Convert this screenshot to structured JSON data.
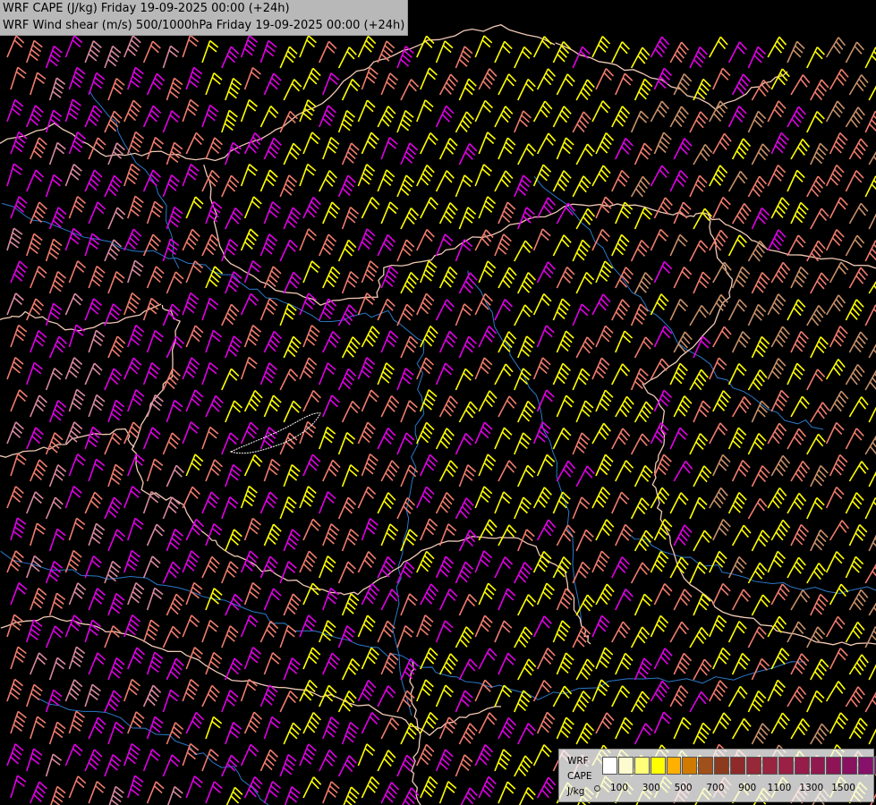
{
  "titles": {
    "line1": "WRF CAPE (J/kg) Friday 19-09-2025 00:00 (+24h)",
    "line2": "WRF Wind shear (m/s) 500/1000hPa Friday 19-09-2025 00:00 (+24h)"
  },
  "legend": {
    "label_top": "WRF",
    "label_mid": "CAPE",
    "label_unit": "J/kg",
    "swatch_colors": [
      "#ffffff",
      "#fbfbcf",
      "#ffff7a",
      "#ffff00",
      "#ffb000",
      "#d07a00",
      "#a0501a",
      "#8b3a1e",
      "#8e2a2a",
      "#962838",
      "#9a2440",
      "#9a2045",
      "#961c4a",
      "#921850",
      "#8e1456",
      "#8a1060",
      "#86106a",
      "#7e1070"
    ],
    "tick_labels": [
      "100",
      "300",
      "500",
      "700",
      "900",
      "1100",
      "1300",
      "1500"
    ]
  },
  "barb_colors": {
    "magenta": "#e000e6",
    "salmon": "#f07c6e",
    "yellow": "#ffff00",
    "tan": "#c8906a",
    "pink": "#d88aa0"
  },
  "map_colors": {
    "background": "#000000",
    "borders": "#f0c8b4",
    "rivers": "#2a78c8",
    "lakes": "#ffffff"
  }
}
